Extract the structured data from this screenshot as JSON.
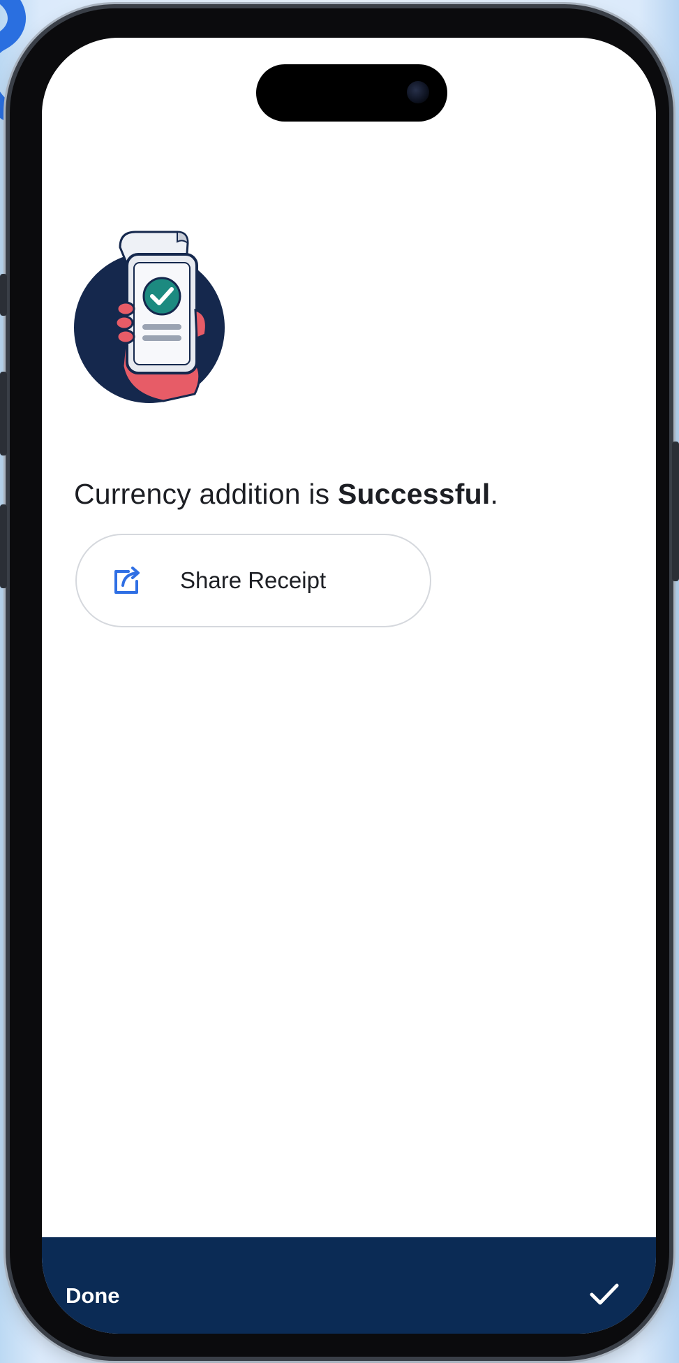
{
  "result": {
    "message_prefix": "Currency addition is ",
    "message_status": "Successful",
    "message_suffix": "."
  },
  "actions": {
    "share_receipt_label": "Share Receipt",
    "share_icon": "share-icon"
  },
  "bottom_bar": {
    "done_label": "Done",
    "confirm_icon": "check-icon"
  },
  "colors": {
    "bottom_bar": "#0b2b55",
    "share_icon": "#2f6fe4",
    "success_badge": "#1c8a80",
    "illustration_circle": "#15284d",
    "hand": "#e75c67"
  }
}
